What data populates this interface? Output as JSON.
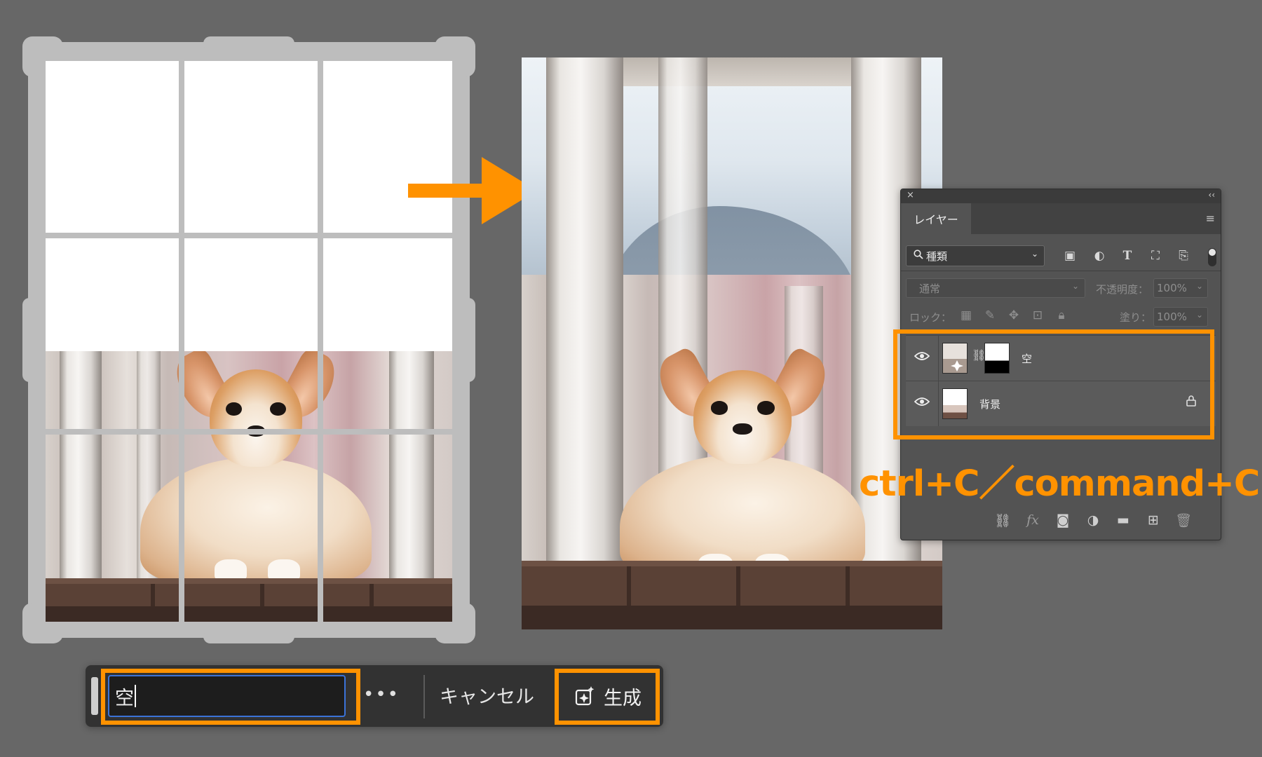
{
  "colors": {
    "background": "#676767",
    "highlight": "#ff9200",
    "panel": "#535353",
    "prompt_border": "#3b73d9"
  },
  "layers_panel": {
    "close_glyph": "×",
    "collapse_glyph": "‹‹",
    "tab_label": "レイヤー",
    "menu_icon": "panel-menu-icon",
    "filter": {
      "kind_label": "種類",
      "icons": [
        "image-icon",
        "adjustment-icon",
        "text-icon",
        "shape-icon",
        "smart-object-icon"
      ]
    },
    "blend_mode": "通常",
    "opacity_label": "不透明度：",
    "opacity_value": "100%",
    "lock_label": "ロック：",
    "fill_label": "塗り：",
    "fill_value": "100%",
    "layers": [
      {
        "name": "空",
        "visible": true,
        "has_mask": true
      },
      {
        "name": "背景",
        "visible": true,
        "locked": true
      }
    ],
    "bottom_icons": [
      "link-icon",
      "fx-icon",
      "mask-icon",
      "adjustment-layer-icon",
      "folder-icon",
      "new-layer-icon",
      "trash-icon"
    ]
  },
  "shortcut_text": "ctrl+C／command+C",
  "generative_bar": {
    "prompt_value": "空",
    "more_label": "•••",
    "cancel_label": "キャンセル",
    "generate_label": "生成"
  }
}
